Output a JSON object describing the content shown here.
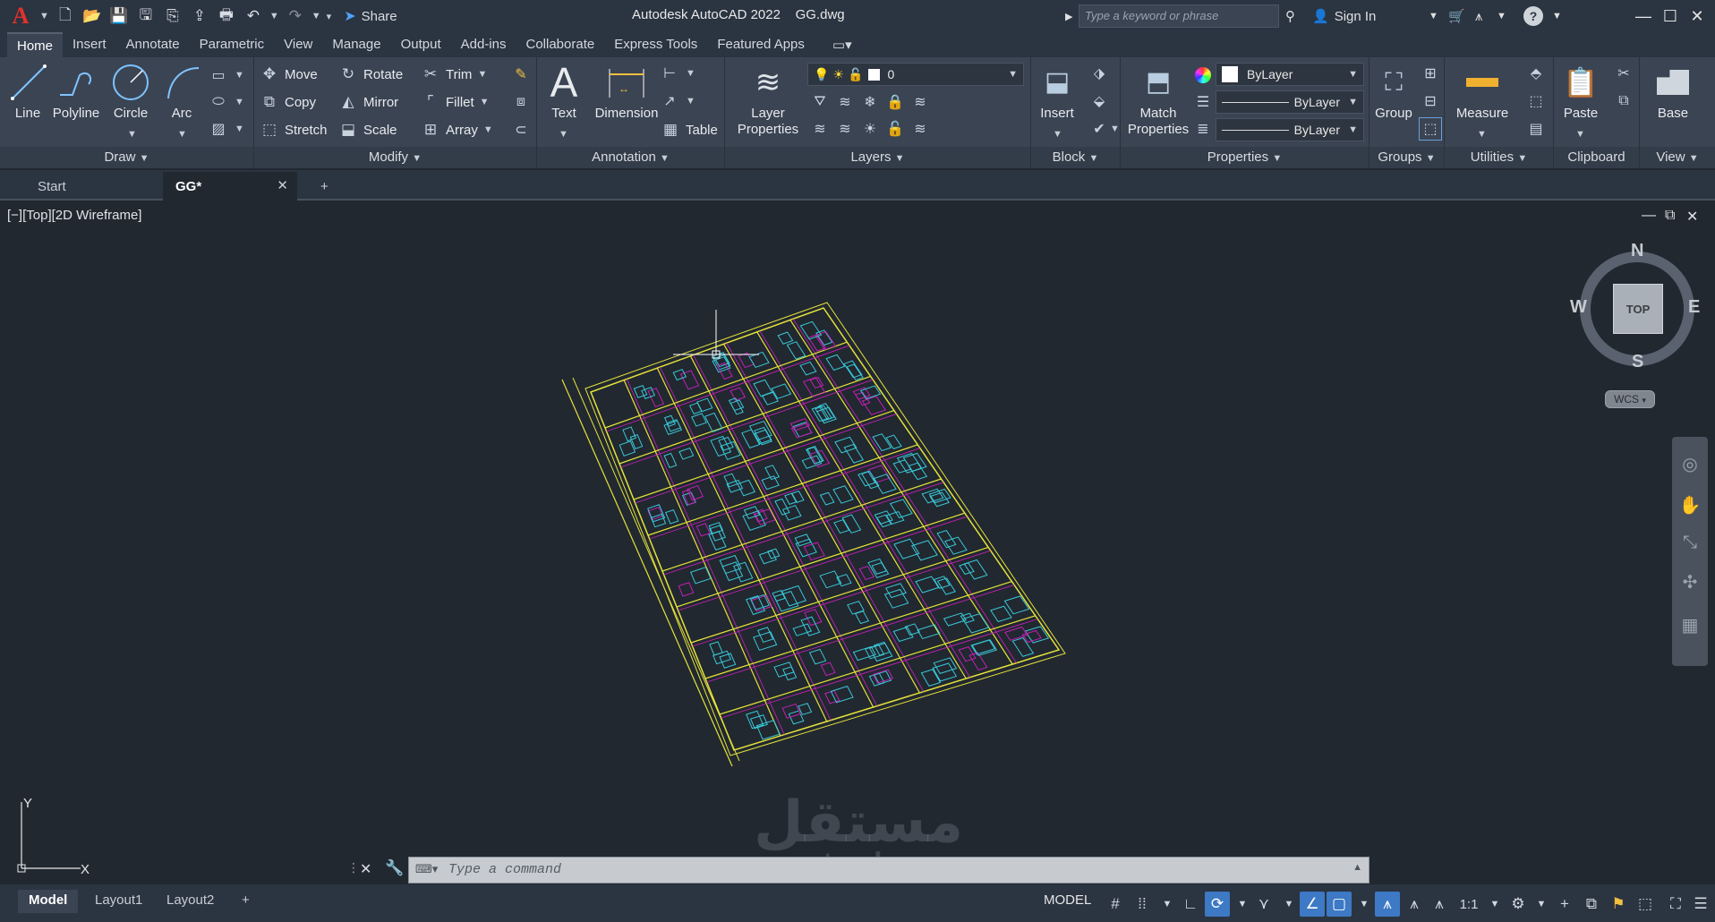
{
  "titlebar": {
    "app_title": "Autodesk AutoCAD 2022",
    "file_name": "GG.dwg",
    "share_label": "Share",
    "search_placeholder": "Type a keyword or phrase",
    "sign_in": "Sign In"
  },
  "ribbon_tabs": [
    "Home",
    "Insert",
    "Annotate",
    "Parametric",
    "View",
    "Manage",
    "Output",
    "Add-ins",
    "Collaborate",
    "Express Tools",
    "Featured Apps"
  ],
  "ribbon": {
    "draw": {
      "title": "Draw",
      "line": "Line",
      "polyline": "Polyline",
      "circle": "Circle",
      "arc": "Arc"
    },
    "modify": {
      "title": "Modify",
      "move": "Move",
      "rotate": "Rotate",
      "trim": "Trim",
      "copy": "Copy",
      "mirror": "Mirror",
      "fillet": "Fillet",
      "stretch": "Stretch",
      "scale": "Scale",
      "array": "Array"
    },
    "annotation": {
      "title": "Annotation",
      "text": "Text",
      "dimension": "Dimension",
      "table": "Table"
    },
    "layers": {
      "title": "Layers",
      "layer_properties_1": "Layer",
      "layer_properties_2": "Properties",
      "current_layer": "0"
    },
    "block": {
      "title": "Block",
      "insert": "Insert"
    },
    "properties": {
      "title": "Properties",
      "match_1": "Match",
      "match_2": "Properties",
      "color": "ByLayer",
      "linetype": "ByLayer",
      "lineweight": "ByLayer"
    },
    "groups": {
      "title": "Groups",
      "group": "Group"
    },
    "utilities": {
      "title": "Utilities",
      "measure": "Measure"
    },
    "clipboard": {
      "title": "Clipboard",
      "paste": "Paste"
    },
    "view": {
      "title": "View",
      "base": "Base"
    }
  },
  "file_tabs": {
    "start": "Start",
    "current": "GG*"
  },
  "viewport": {
    "label": "[−][Top][2D Wireframe]",
    "viewcube": {
      "n": "N",
      "s": "S",
      "e": "E",
      "w": "W",
      "face": "TOP",
      "wcs": "WCS"
    }
  },
  "command": {
    "placeholder": "Type  a  command"
  },
  "layout_tabs": [
    "Model",
    "Layout1",
    "Layout2"
  ],
  "status": {
    "model": "MODEL",
    "scale": "1:1"
  },
  "watermark": {
    "line1": "مستقل",
    "line2": "mostaql.com"
  },
  "colors": {
    "titlebar": "#2b3441",
    "ribbon": "#3b4453",
    "canvas": "#212830",
    "accent": "#3d79c4",
    "drawing_yellow": "#e5e23a",
    "drawing_cyan": "#39c7d6",
    "drawing_magenta": "#c21fb5"
  }
}
